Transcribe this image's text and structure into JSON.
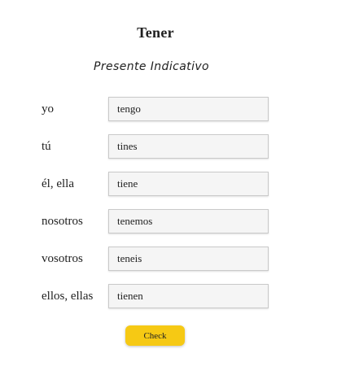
{
  "header": {
    "title": "Tener",
    "subtitle": "Presente Indicativo"
  },
  "rows": [
    {
      "pronoun": "yo",
      "answer": "tengo"
    },
    {
      "pronoun": "tú",
      "answer": "tines"
    },
    {
      "pronoun": "él, ella",
      "answer": "tiene"
    },
    {
      "pronoun": "nosotros",
      "answer": "tenemos"
    },
    {
      "pronoun": "vosotros",
      "answer": "teneis"
    },
    {
      "pronoun": "ellos, ellas",
      "answer": "tienen"
    }
  ],
  "actions": {
    "check_label": "Check"
  },
  "colors": {
    "check_button": "#f6c914"
  }
}
